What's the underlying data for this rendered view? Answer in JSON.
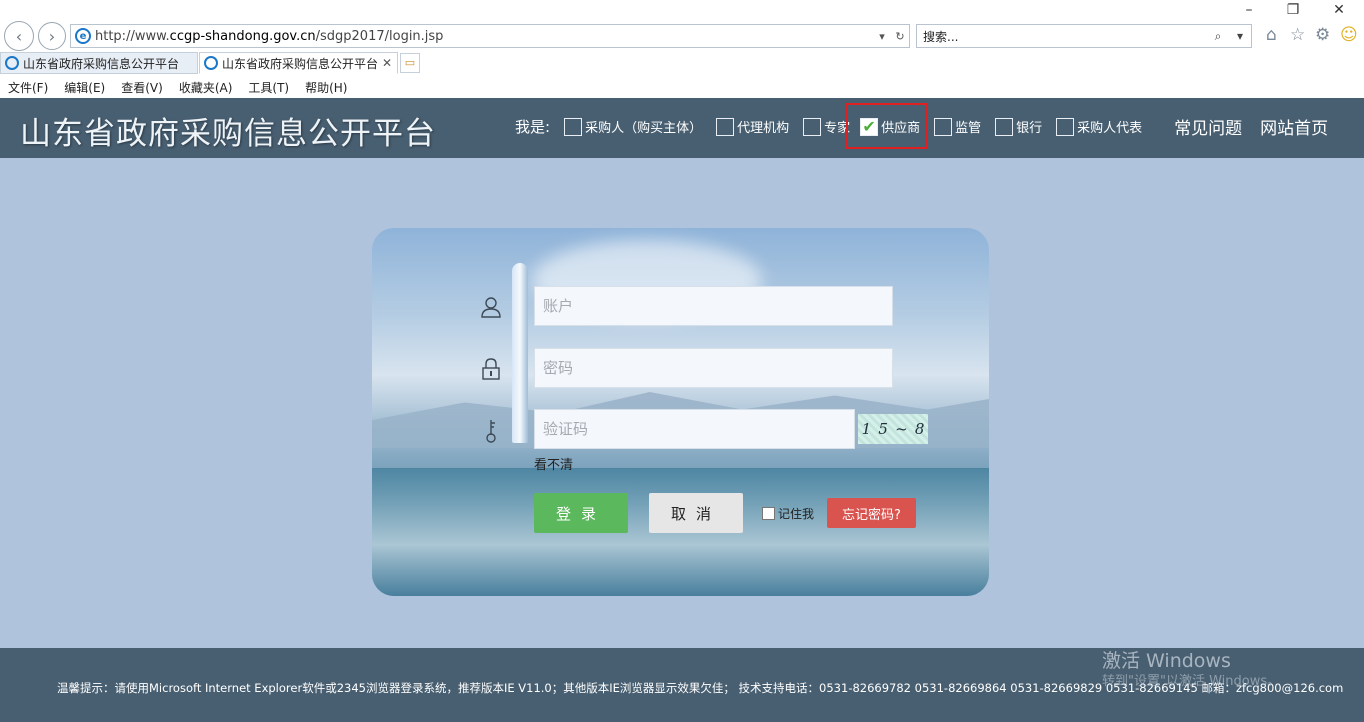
{
  "browser": {
    "window_controls": [
      "–",
      "❐",
      "✕"
    ],
    "url_prefix": "http://www.",
    "url_host": "ccgp-shandong.gov.cn",
    "url_path": "/sdgp2017/login.jsp",
    "search_placeholder": "搜索...",
    "tabs": [
      {
        "label": "山东省政府采购信息公开平台",
        "active": false
      },
      {
        "label": "山东省政府采购信息公开平台",
        "active": true
      }
    ],
    "menu": [
      "文件(F)",
      "编辑(E)",
      "查看(V)",
      "收藏夹(A)",
      "工具(T)",
      "帮助(H)"
    ]
  },
  "header": {
    "title": "山东省政府采购信息公开平台",
    "role_label": "我是:",
    "roles": [
      {
        "label": "采购人（购买主体）",
        "checked": false
      },
      {
        "label": "代理机构",
        "checked": false
      },
      {
        "label": "专家",
        "checked": false
      },
      {
        "label": "供应商",
        "checked": true
      },
      {
        "label": "监管",
        "checked": false
      },
      {
        "label": "银行",
        "checked": false
      },
      {
        "label": "采购人代表",
        "checked": false
      }
    ],
    "links": [
      "常见问题",
      "网站首页"
    ]
  },
  "login": {
    "account_placeholder": "账户",
    "password_placeholder": "密码",
    "captcha_placeholder": "验证码",
    "captcha_text": [
      "1",
      "5",
      "~",
      "8"
    ],
    "refresh_label": "看不清",
    "login_label": "登录",
    "cancel_label": "取消",
    "remember_label": "记住我",
    "forgot_label": "忘记密码?"
  },
  "footer": {
    "tip": "温馨提示：请使用Microsoft Internet Explorer软件或2345浏览器登录系统，推荐版本IE V11.0；其他版本IE浏览器显示效果欠佳；  技术支持电话：0531-82669782 0531-82669864 0531-82669829 0531-82669145 邮箱：zfcg800@126.com"
  },
  "watermark": {
    "line1": "激活 Windows",
    "line2": "转到\"设置\"以激活 Windows。"
  },
  "colors": {
    "header_bg": "#485f71",
    "page_bg": "#afc3dd",
    "login_green": "#5cb85c",
    "forgot_red": "#d9534f",
    "highlight_red": "#e02020"
  }
}
